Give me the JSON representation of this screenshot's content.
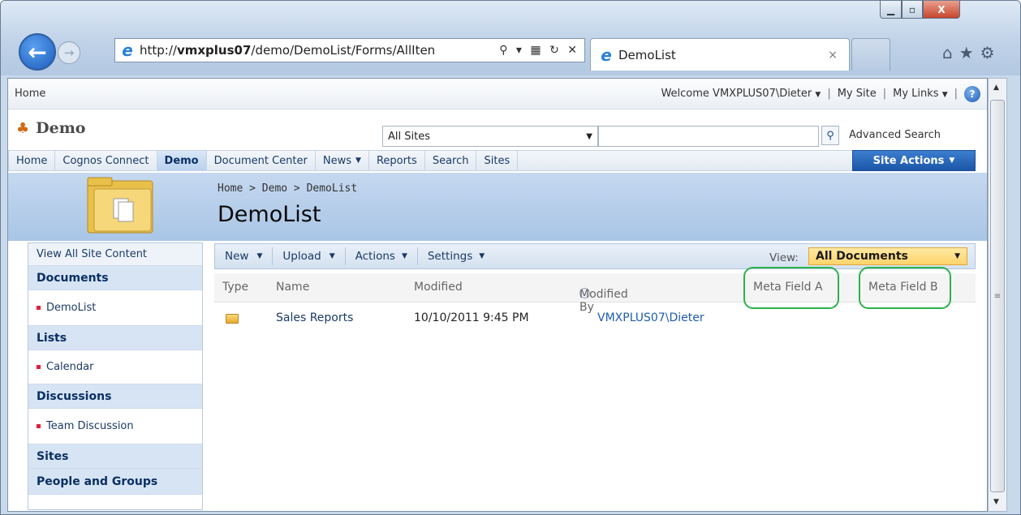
{
  "browser": {
    "url_prefix": "http://",
    "url_host": "vmxplus07",
    "url_path": "/demo/DemoList/Forms/AllIten",
    "tab_title": "DemoList",
    "tab_close": "×",
    "window_close": "X",
    "address_tools": "⚲ ▾ ▦ ↻ ✕",
    "toolbar_icons": "⌂★⚙"
  },
  "topbar": {
    "home": "Home",
    "welcome": "Welcome VMXPLUS07\\Dieter",
    "my_site": "My Site",
    "my_links": "My Links",
    "help": "?"
  },
  "brand": {
    "title": "Demo"
  },
  "search": {
    "scope": "All Sites",
    "value": "",
    "advanced": "Advanced Search"
  },
  "nav": {
    "items": [
      "Home",
      "Cognos Connect",
      "Demo",
      "Document Center",
      "News",
      "Reports",
      "Search",
      "Sites"
    ],
    "site_actions": "Site Actions"
  },
  "page": {
    "breadcrumb": "Home > Demo > DemoList",
    "title": "DemoList"
  },
  "quicklaunch": {
    "view_all": "View All Site Content",
    "documents": "Documents",
    "demolist": "DemoList",
    "lists": "Lists",
    "calendar": "Calendar",
    "discussions": "Discussions",
    "team_discussion": "Team Discussion",
    "sites": "Sites",
    "people": "People and Groups"
  },
  "toolbar": {
    "new": "New",
    "upload": "Upload",
    "actions": "Actions",
    "settings": "Settings",
    "view_label": "View:",
    "view_value": "All Documents"
  },
  "table": {
    "headers": [
      "Type",
      "Name",
      "Modified",
      "Modified By",
      "Meta Field A",
      "Meta Field B"
    ],
    "rows": [
      {
        "name": "Sales Reports",
        "modified": "10/10/2011 9:45 PM",
        "modified_by": "VMXPLUS07\\Dieter"
      }
    ]
  }
}
